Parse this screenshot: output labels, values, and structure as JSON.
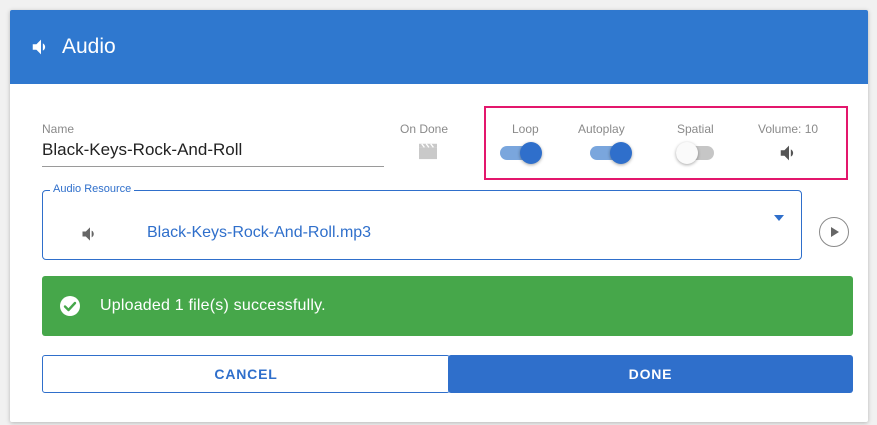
{
  "window": {
    "title": "Audio",
    "title_icon": "volume-icon"
  },
  "form": {
    "name_label": "Name",
    "name_value": "Black-Keys-Rock-And-Roll",
    "on_done_label": "On Done",
    "on_done_icon": "clapperboard-icon",
    "options": {
      "loop_label": "Loop",
      "loop_on": true,
      "autoplay_label": "Autoplay",
      "autoplay_on": true,
      "spatial_label": "Spatial",
      "spatial_on": false,
      "volume_label": "Volume: 10",
      "volume_icon": "volume-icon"
    },
    "resource": {
      "legend": "Audio Resource",
      "selected_value": "Black-Keys-Rock-And-Roll.mp3",
      "icon": "volume-icon"
    }
  },
  "status": {
    "message": "Uploaded 1 file(s) successfully.",
    "icon": "check-circle-icon"
  },
  "actions": {
    "cancel_label": "CANCEL",
    "done_label": "DONE"
  },
  "colors": {
    "primary": "#2f78cf",
    "success": "#46a74a",
    "highlight": "#e3176c"
  }
}
